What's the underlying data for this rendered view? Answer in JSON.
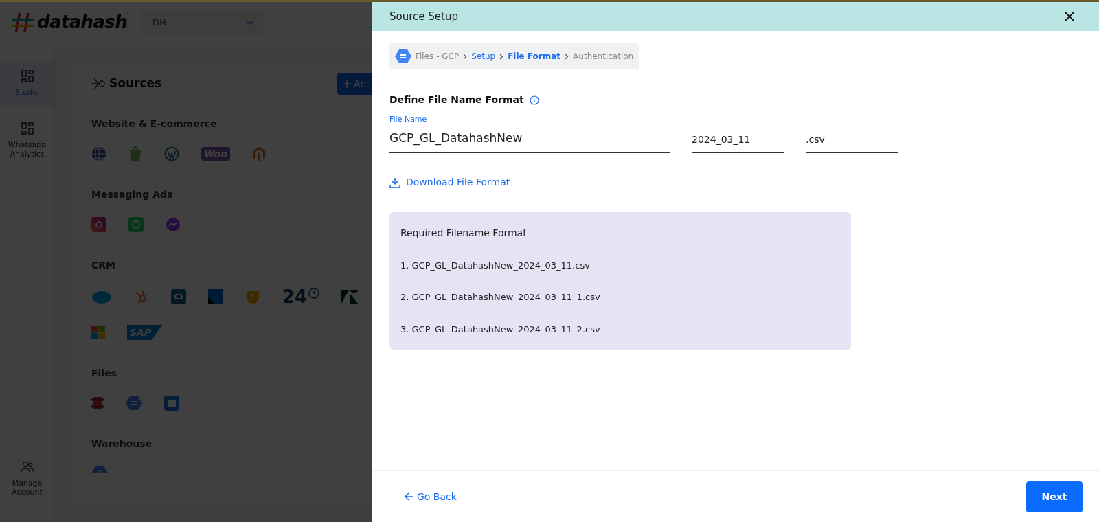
{
  "app": {
    "logo": "datahash",
    "workspace_select": {
      "value": "DH"
    },
    "sidebar": {
      "items": [
        {
          "label": "Studio",
          "selected": true,
          "kind": "grid"
        },
        {
          "label": "Whatsapp Analytics",
          "selected": false,
          "kind": "grid"
        }
      ],
      "bottom_items": [
        {
          "label": "Manage Account",
          "selected": false,
          "kind": "users"
        }
      ]
    },
    "sources": {
      "title": "Sources",
      "add_button": "Ac",
      "categories": [
        {
          "title": "Website & E-commerce",
          "icons": [
            {
              "kind": "globe"
            },
            {
              "kind": "shopify"
            },
            {
              "kind": "wordpress"
            },
            {
              "kind": "woo",
              "text": "Woo"
            },
            {
              "kind": "magento"
            }
          ]
        },
        {
          "title": "Messaging Ads",
          "icons": [
            {
              "kind": "instagram"
            },
            {
              "kind": "whatsapp"
            },
            {
              "kind": "messenger"
            }
          ]
        },
        {
          "title": "CRM",
          "icons": [
            {
              "kind": "salesforce"
            },
            {
              "kind": "hubspot"
            },
            {
              "kind": "zoho"
            },
            {
              "kind": "square"
            },
            {
              "kind": "shield"
            },
            {
              "kind": "clock24",
              "text": "24"
            },
            {
              "kind": "zendesk"
            },
            {
              "kind": "microsoft"
            },
            {
              "kind": "sap",
              "text": "SAP"
            }
          ]
        },
        {
          "title": "Files",
          "icons": [
            {
              "kind": "s3"
            },
            {
              "kind": "gcs"
            },
            {
              "kind": "folder"
            }
          ]
        },
        {
          "title": "Warehouse",
          "icons": [
            {
              "kind": "bigquery"
            }
          ]
        }
      ]
    }
  },
  "drawer": {
    "title": "Source Setup",
    "breadcrumb": [
      {
        "label": "Files - GCP",
        "visited": false,
        "selected": false
      },
      {
        "label": "Setup",
        "visited": true,
        "selected": false
      },
      {
        "label": "File Format",
        "visited": true,
        "selected": true
      },
      {
        "label": "Authentication",
        "visited": false,
        "selected": false
      }
    ],
    "section_title": "Define File Name Format",
    "fields": [
      {
        "label": "File Name",
        "value": "GCP_GL_DatahashNew",
        "kind": "wide"
      },
      {
        "value": "2024_03_11",
        "kind": "narrow"
      },
      {
        "value": ".csv",
        "kind": "narrow"
      }
    ],
    "download_link": "Download File Format",
    "info_box": {
      "title": "Required Filename Format",
      "lines": [
        "1. GCP_GL_DatahashNew_2024_03_11.csv",
        "2. GCP_GL_DatahashNew_2024_03_11_1.csv",
        "3. GCP_GL_DatahashNew_2024_03_11_2.csv"
      ]
    },
    "footer": {
      "back": "Go Back",
      "next": "Next"
    }
  }
}
